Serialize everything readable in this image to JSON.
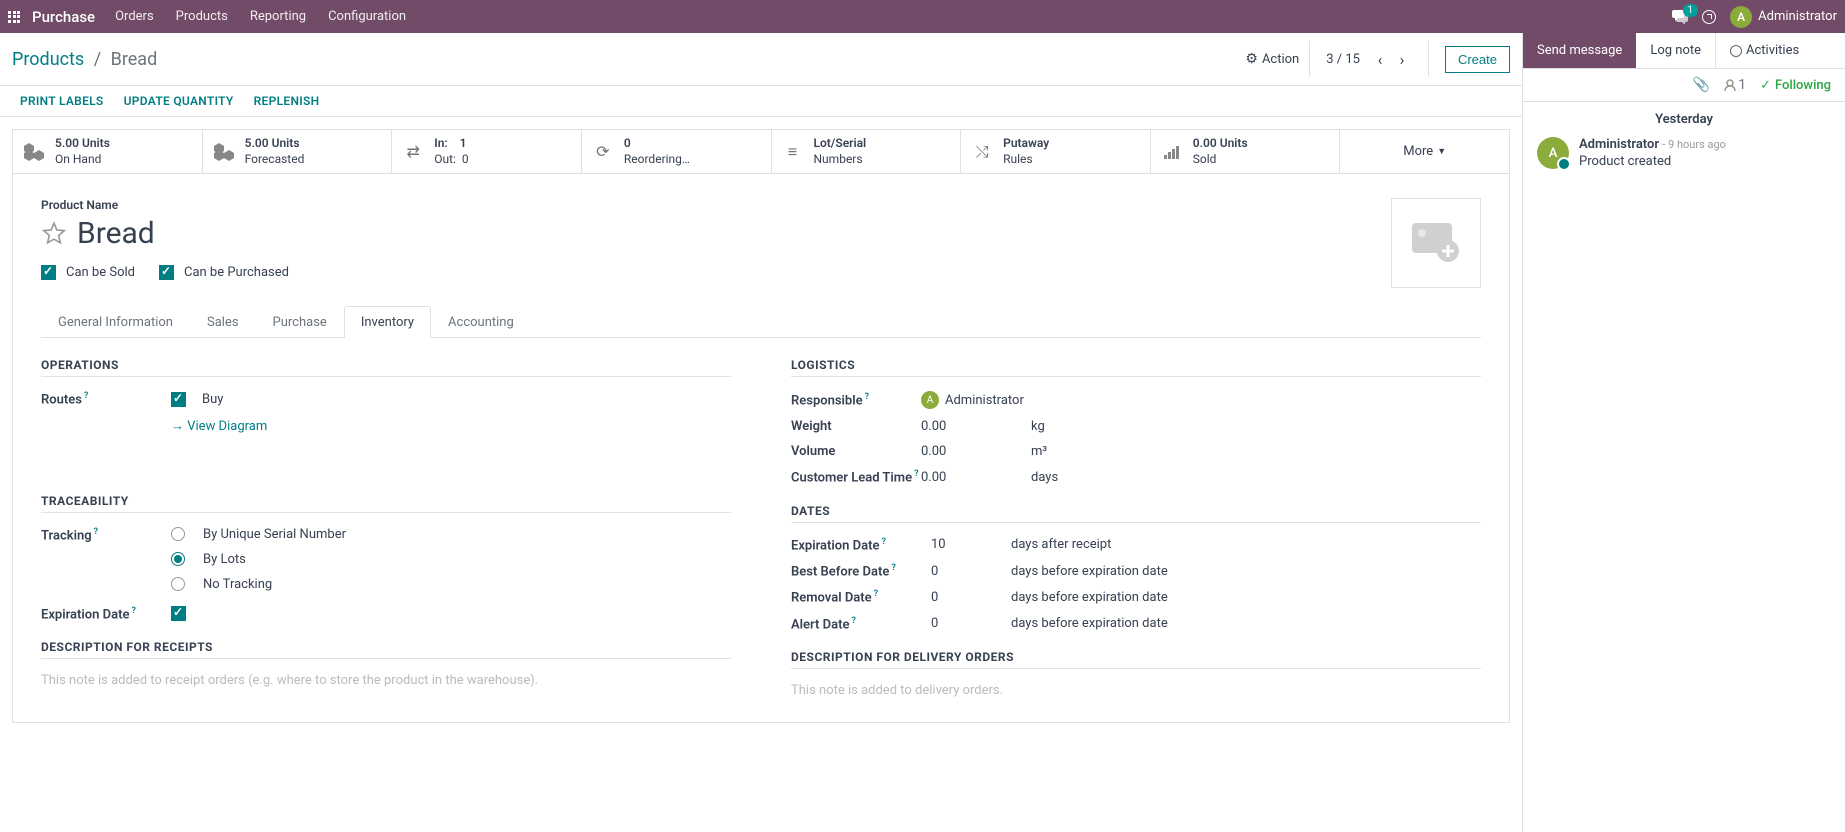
{
  "topbar": {
    "app": "Purchase",
    "menu": [
      "Orders",
      "Products",
      "Reporting",
      "Configuration"
    ],
    "chat_count": "1",
    "user": "Administrator",
    "user_initial": "A"
  },
  "breadcrumb": {
    "parent": "Products",
    "current": "Bread",
    "action": "Action",
    "pager": "3 / 15",
    "create": "Create"
  },
  "actions": [
    "PRINT LABELS",
    "UPDATE QUANTITY",
    "REPLENISH"
  ],
  "stats": {
    "onhand": {
      "top": "5.00 Units",
      "bot": "On Hand"
    },
    "forecast": {
      "top": "5.00 Units",
      "bot": "Forecasted"
    },
    "inout": {
      "in_lbl": "In:",
      "in_val": "1",
      "out_lbl": "Out:",
      "out_val": "0"
    },
    "reorder": {
      "top": "0",
      "bot": "Reordering…"
    },
    "lot": {
      "top": "Lot/Serial",
      "bot": "Numbers"
    },
    "putaway": {
      "top": "Putaway",
      "bot": "Rules"
    },
    "sold": {
      "top": "0.00 Units",
      "bot": "Sold"
    },
    "more": "More"
  },
  "product": {
    "label": "Product Name",
    "name": "Bread",
    "can_sold": "Can be Sold",
    "can_purchased": "Can be Purchased"
  },
  "tabs": [
    "General Information",
    "Sales",
    "Purchase",
    "Inventory",
    "Accounting"
  ],
  "inventory": {
    "operations_title": "OPERATIONS",
    "routes_label": "Routes",
    "buy": "Buy",
    "view_diagram": "View Diagram",
    "traceability_title": "TRACEABILITY",
    "tracking_label": "Tracking",
    "tracking_opts": [
      "By Unique Serial Number",
      "By Lots",
      "No Tracking"
    ],
    "expiration_label": "Expiration Date",
    "desc_receipts_title": "DESCRIPTION FOR RECEIPTS",
    "desc_receipts_placeholder": "This note is added to receipt orders (e.g. where to store the product in the warehouse).",
    "logistics_title": "LOGISTICS",
    "responsible_label": "Responsible",
    "responsible_value": "Administrator",
    "weight_label": "Weight",
    "weight_val": "0.00",
    "weight_unit": "kg",
    "volume_label": "Volume",
    "volume_val": "0.00",
    "volume_unit": "m³",
    "lead_label": "Customer Lead Time",
    "lead_val": "0.00",
    "lead_unit": "days",
    "dates_title": "DATES",
    "exp_label": "Expiration Date",
    "exp_val": "10",
    "exp_unit": "days after receipt",
    "bbd_label": "Best Before Date",
    "bbd_val": "0",
    "bbd_unit": "days before expiration date",
    "rem_label": "Removal Date",
    "rem_val": "0",
    "rem_unit": "days before expiration date",
    "alert_label": "Alert Date",
    "alert_val": "0",
    "alert_unit": "days before expiration date",
    "desc_delivery_title": "DESCRIPTION FOR DELIVERY ORDERS",
    "desc_delivery_placeholder": "This note is added to delivery orders."
  },
  "chatter": {
    "send": "Send message",
    "log": "Log note",
    "activities": "Activities",
    "follower_count": "1",
    "following": "Following",
    "date_sep": "Yesterday",
    "msg_author": "Administrator",
    "msg_time": "- 9 hours ago",
    "msg_body": "Product created",
    "msg_initial": "A"
  }
}
